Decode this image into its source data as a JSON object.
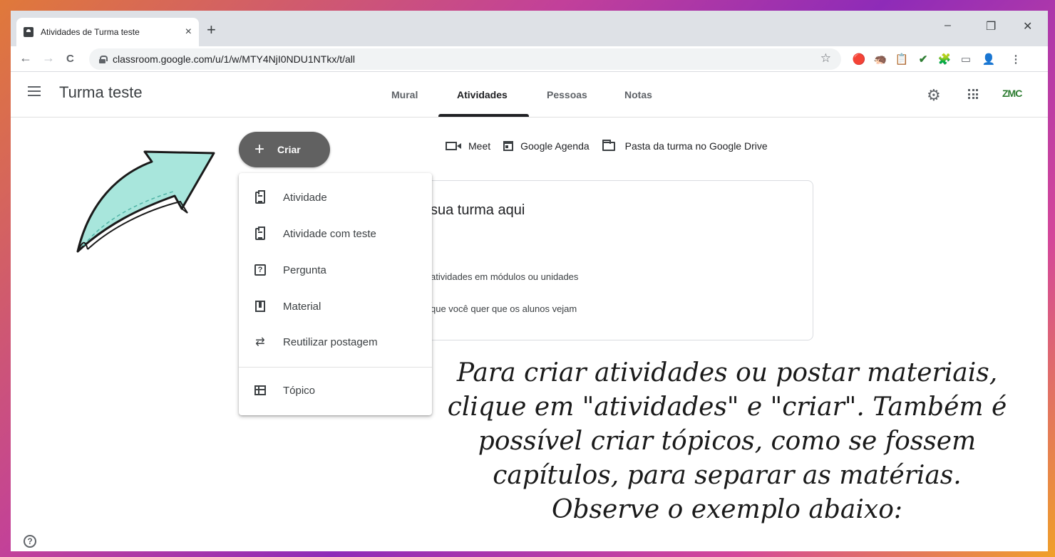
{
  "browser": {
    "tab_title": "Atividades de Turma teste",
    "tab_close": "×",
    "new_tab": "+",
    "minimize": "–",
    "restore": "❐",
    "close": "✕",
    "back": "←",
    "forward": "→",
    "reload": "C",
    "url": "classroom.google.com/u/1/w/MTY4NjI0NDU1NTkx/t/all",
    "star": "☆",
    "extensions": [
      "🔴",
      "🦔",
      "📋",
      "✔",
      "🧩",
      "▭",
      "👤",
      "⋮"
    ]
  },
  "app": {
    "class_name": "Turma teste",
    "tabs": [
      {
        "label": "Mural"
      },
      {
        "label": "Atividades"
      },
      {
        "label": "Pessoas"
      },
      {
        "label": "Notas"
      }
    ],
    "active_tab": "Atividades",
    "settings_icon": "⚙",
    "logo_text": "ZMC"
  },
  "create_button": {
    "plus": "+",
    "label": "Criar"
  },
  "links": {
    "meet": "Meet",
    "calendar": "Google Agenda",
    "drive": "Pasta da turma no Google Drive"
  },
  "create_menu": {
    "items": [
      {
        "label": "Atividade",
        "icon": "assignment-icon"
      },
      {
        "label": "Atividade com teste",
        "icon": "quiz-assignment-icon"
      },
      {
        "label": "Pergunta",
        "icon": "question-icon"
      },
      {
        "label": "Material",
        "icon": "material-icon"
      },
      {
        "label": "Reutilizar postagem",
        "icon": "reuse-icon"
      },
      {
        "label": "Tópico",
        "icon": "topic-icon"
      }
    ]
  },
  "empty_card": {
    "title_partial": "sua turma aqui",
    "line1_partial": "atividades em módulos ou unidades",
    "line2_partial": "que você quer que os alunos vejam"
  },
  "help": "?",
  "annotation": {
    "text": "Para criar atividades ou postar materiais, clique em \"atividades\" e \"criar\". Também é possível criar tópicos, como se fossem capítulos, para separar as matérias. Observe o exemplo abaixo:",
    "arrow_color": "#a8e6dc"
  }
}
